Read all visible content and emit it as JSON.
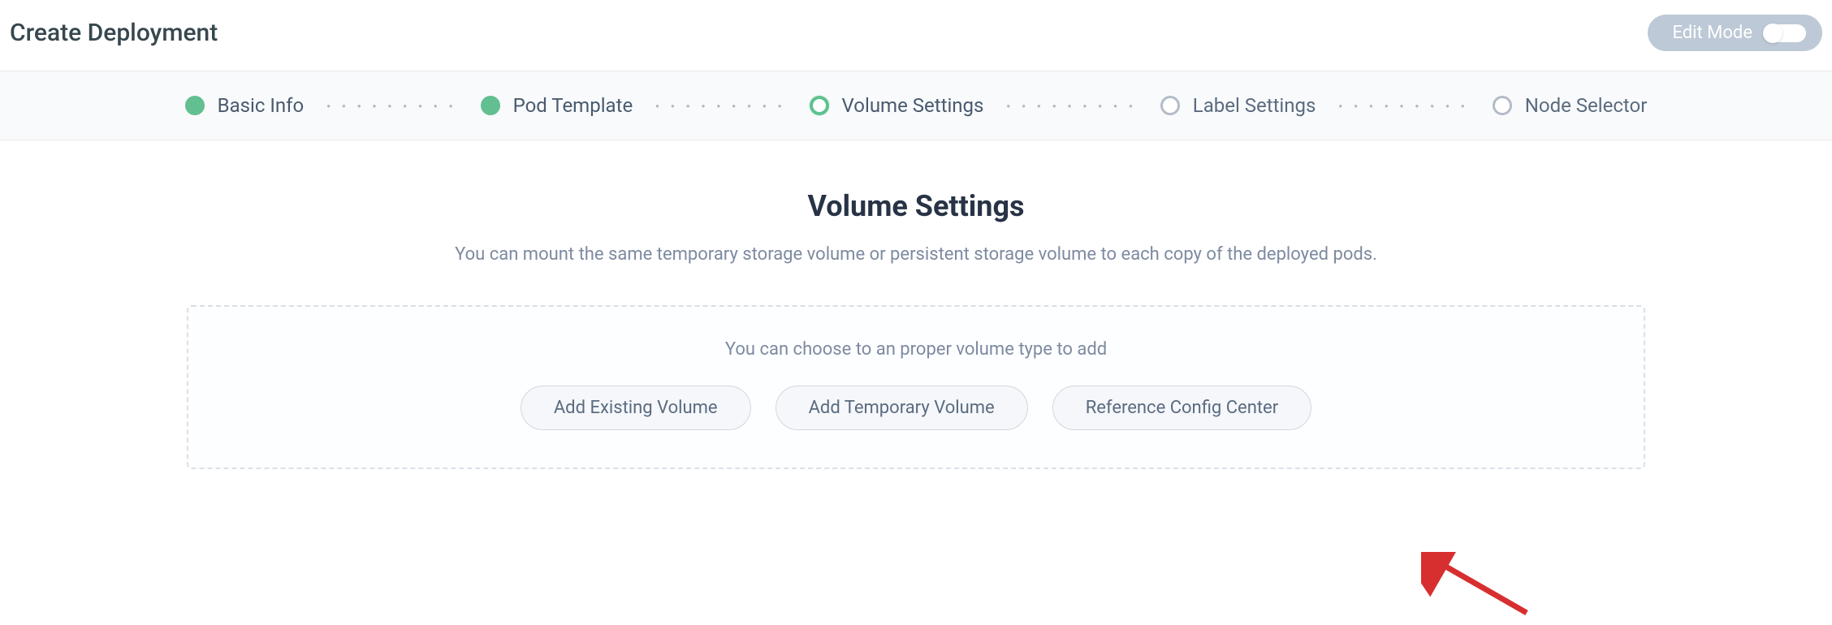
{
  "header": {
    "title": "Create Deployment",
    "edit_mode_label": "Edit Mode"
  },
  "steps": [
    {
      "label": "Basic Info",
      "state": "completed"
    },
    {
      "label": "Pod Template",
      "state": "completed"
    },
    {
      "label": "Volume Settings",
      "state": "active"
    },
    {
      "label": "Label Settings",
      "state": "pending"
    },
    {
      "label": "Node Selector",
      "state": "pending"
    }
  ],
  "section": {
    "title": "Volume Settings",
    "description": "You can mount the same temporary storage volume or persistent storage volume to each copy of the deployed pods."
  },
  "volume_box": {
    "hint": "You can choose to an proper volume type to add",
    "buttons": {
      "existing": "Add Existing Volume",
      "temporary": "Add Temporary Volume",
      "config": "Reference Config Center"
    }
  }
}
